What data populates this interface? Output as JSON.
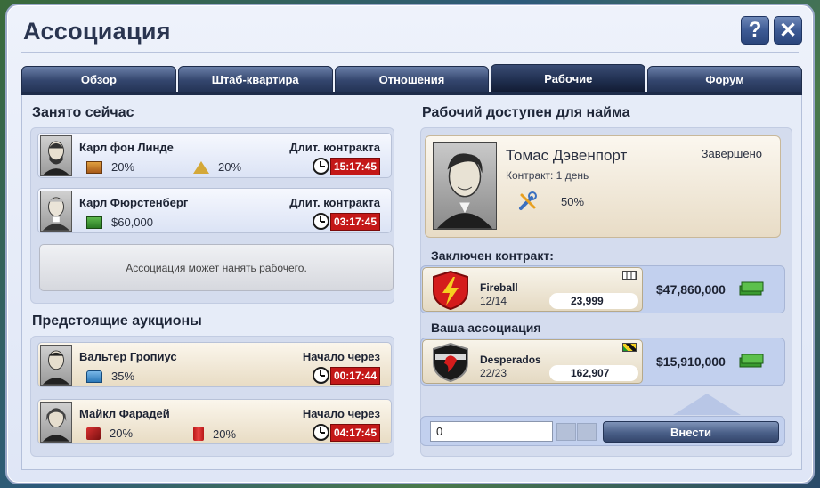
{
  "window": {
    "title": "Ассоциация",
    "help_label": "?",
    "close_label": "✕"
  },
  "tabs": [
    {
      "label": "Обзор",
      "active": false
    },
    {
      "label": "Штаб-квартира",
      "active": false
    },
    {
      "label": "Отношения",
      "active": false
    },
    {
      "label": "Рабочие",
      "active": true
    },
    {
      "label": "Форум",
      "active": false
    }
  ],
  "busy": {
    "title": "Занято сейчас",
    "workers": [
      {
        "name": "Карл фон Линде",
        "right_label": "Длит. контракта",
        "timer": "15:17:45",
        "stats": [
          {
            "icon": "brick-icon",
            "value": "20%"
          },
          {
            "icon": "pyramid-icon",
            "value": "20%"
          }
        ]
      },
      {
        "name": "Карл Фюрстенберг",
        "right_label": "Длит. контракта",
        "timer": "03:17:45",
        "stats": [
          {
            "icon": "cash-icon",
            "value": "$60,000"
          }
        ]
      }
    ],
    "notice": "Ассоциация может нанять рабочего."
  },
  "auctions": {
    "title": "Предстоящие аукционы",
    "workers": [
      {
        "name": "Вальтер Гропиус",
        "right_label": "Начало через",
        "timer": "00:17:44",
        "stats": [
          {
            "icon": "house-icon",
            "value": "35%"
          }
        ]
      },
      {
        "name": "Майкл Фарадей",
        "right_label": "Начало через",
        "timer": "04:17:45",
        "stats": [
          {
            "icon": "fuel-nozzle-icon",
            "value": "20%"
          },
          {
            "icon": "fuel-barrel-icon",
            "value": "20%"
          }
        ]
      }
    ]
  },
  "available": {
    "title": "Рабочий доступен для найма",
    "name": "Томас Дэвенпорт",
    "status": "Завершено",
    "contract": "Контракт: 1 день",
    "stat": {
      "icon": "tools-icon",
      "value": "50%"
    }
  },
  "contracted": {
    "title": "Заключен контракт:",
    "team": "Fireball",
    "count": "12/14",
    "score": "23,999",
    "money": "$47,860,000"
  },
  "your_assoc": {
    "title": "Ваша ассоциация",
    "team": "Desperados",
    "count": "22/23",
    "score": "162,907",
    "money": "$15,910,000"
  },
  "deposit": {
    "input_value": "0",
    "button_label": "Внести"
  },
  "colors": {
    "tab_dark": "#243456",
    "timer_red": "#c41818",
    "accent_blue": "#c2d0ee"
  }
}
